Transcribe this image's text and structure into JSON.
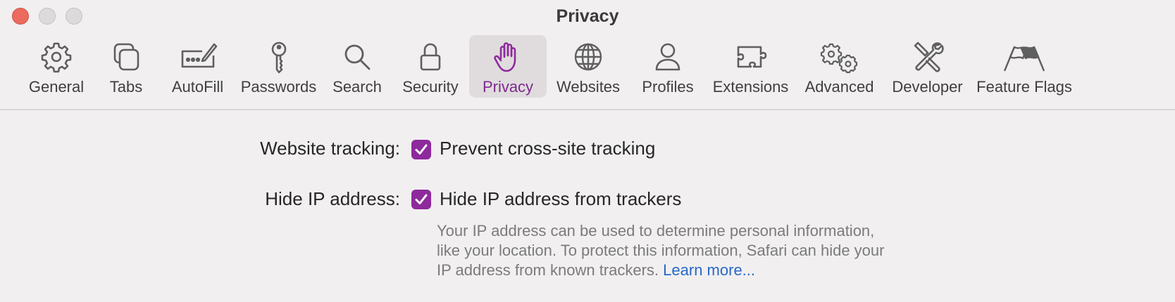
{
  "window": {
    "title": "Privacy"
  },
  "toolbar": {
    "items": [
      {
        "label": "General",
        "icon": "gear-icon"
      },
      {
        "label": "Tabs",
        "icon": "tabs-icon"
      },
      {
        "label": "AutoFill",
        "icon": "autofill-pencil-icon"
      },
      {
        "label": "Passwords",
        "icon": "key-icon"
      },
      {
        "label": "Search",
        "icon": "search-icon"
      },
      {
        "label": "Security",
        "icon": "lock-icon"
      },
      {
        "label": "Privacy",
        "icon": "hand-icon",
        "selected": true
      },
      {
        "label": "Websites",
        "icon": "globe-icon"
      },
      {
        "label": "Profiles",
        "icon": "person-icon"
      },
      {
        "label": "Extensions",
        "icon": "puzzle-icon"
      },
      {
        "label": "Advanced",
        "icon": "gears-icon"
      },
      {
        "label": "Developer",
        "icon": "tools-icon"
      },
      {
        "label": "Feature Flags",
        "icon": "flags-icon"
      }
    ]
  },
  "settings": {
    "tracking": {
      "label": "Website tracking:",
      "option": "Prevent cross-site tracking",
      "checked": true
    },
    "hide_ip": {
      "label": "Hide IP address:",
      "option": "Hide IP address from trackers",
      "checked": true,
      "description_lines": [
        "Your IP address can be used to determine personal information,",
        "like your location. To protect this information, Safari can hide your",
        "IP address from known trackers."
      ],
      "learn_more": "Learn more..."
    }
  },
  "colors": {
    "accent": "#8e2a9c",
    "selected_label": "#7d2a8e",
    "link": "#2869c6",
    "close_button": "#ec6a5e"
  }
}
